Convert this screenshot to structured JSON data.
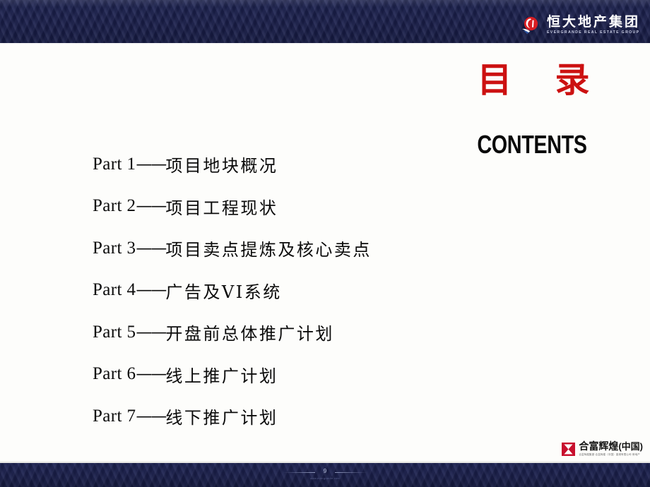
{
  "header": {
    "brand_cn": "恒大地产集团",
    "brand_en": "EVERGRANDE REAL ESTATE GROUP",
    "logo_icon": "evergrande-circle-mark",
    "band_color": "#1a1f4c"
  },
  "title": {
    "cn": "目 录",
    "en": "CONTENTS",
    "cn_color": "#cc1111",
    "en_color": "#0a0a0a"
  },
  "contents": {
    "items": [
      {
        "part": "Part 1",
        "dash": "——",
        "label": "项目地块概况"
      },
      {
        "part": "Part 2",
        "dash": "——",
        "label": "项目工程现状"
      },
      {
        "part": "Part 3",
        "dash": "——",
        "label": "项目卖点提炼及核心卖点"
      },
      {
        "part": "Part 4",
        "dash": "——",
        "label": "广告及VI系统"
      },
      {
        "part": "Part 5",
        "dash": "——",
        "label": "开盘前总体推广计划"
      },
      {
        "part": "Part 6",
        "dash": "——",
        "label": "线上推广计划"
      },
      {
        "part": "Part 7",
        "dash": "——",
        "label": "线下推广计划"
      }
    ]
  },
  "footer": {
    "agency_cn": "合富辉煌",
    "agency_region": "(中国)",
    "agency_micro": "合富辉煌集团·合富辉煌（中国）香港有限公司·房地产",
    "logo_icon": "hopefluent-hourglass-mark",
    "page_number": "9",
    "page_micro": "www.evergrande.com",
    "band_color": "#1a1f4b"
  }
}
